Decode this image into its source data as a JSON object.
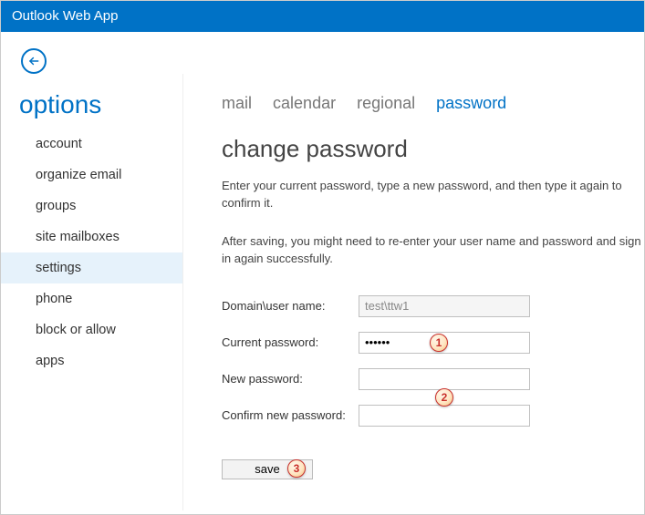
{
  "titlebar": {
    "app_name": "Outlook Web App"
  },
  "options_heading": "options",
  "sidebar": {
    "items": [
      {
        "label": "account"
      },
      {
        "label": "organize email"
      },
      {
        "label": "groups"
      },
      {
        "label": "site mailboxes"
      },
      {
        "label": "settings",
        "selected": true
      },
      {
        "label": "phone"
      },
      {
        "label": "block or allow"
      },
      {
        "label": "apps"
      }
    ]
  },
  "tabs": {
    "items": [
      {
        "label": "mail"
      },
      {
        "label": "calendar"
      },
      {
        "label": "regional"
      },
      {
        "label": "password",
        "active": true
      }
    ]
  },
  "page": {
    "heading": "change password",
    "desc1": "Enter your current password, type a new password, and then type it again to confirm it.",
    "desc2": "After saving, you might need to re-enter your user name and password and sign in again successfully."
  },
  "form": {
    "domain_label": "Domain\\user name:",
    "domain_value": "test\\ttw1",
    "current_label": "Current password:",
    "current_value": "••••••",
    "new_label": "New password:",
    "new_value": "",
    "confirm_label": "Confirm new password:",
    "confirm_value": "",
    "save_label": "save"
  },
  "markers": {
    "m1": "1",
    "m2": "2",
    "m3": "3"
  }
}
